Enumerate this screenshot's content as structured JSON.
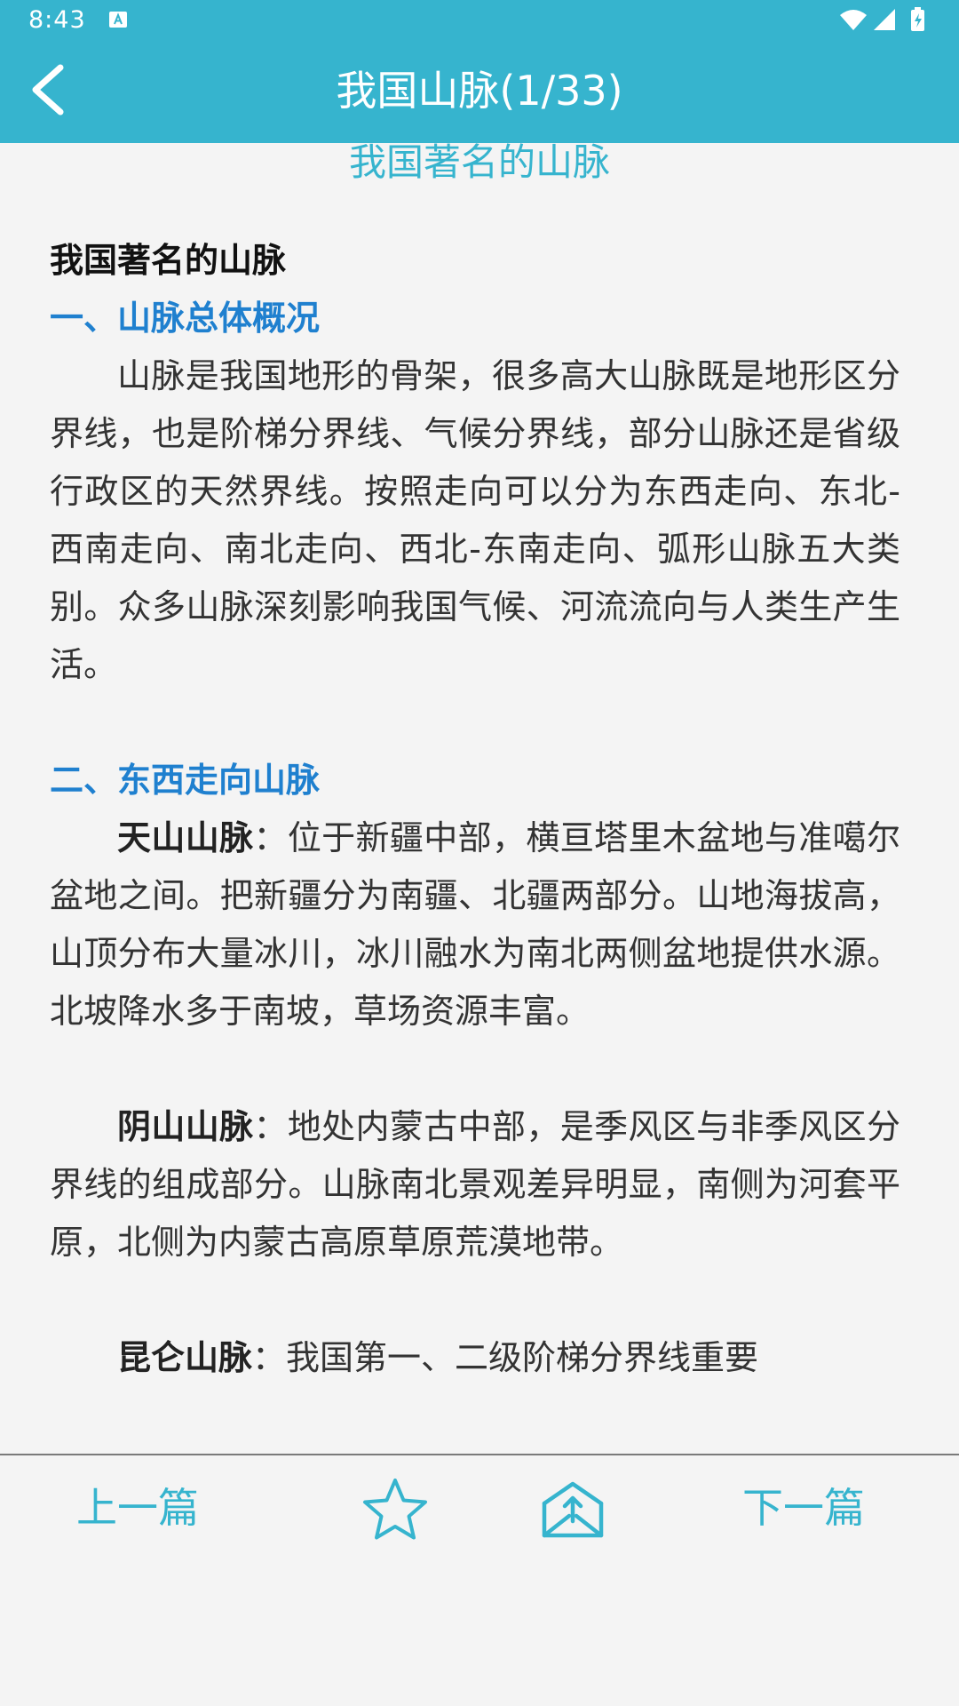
{
  "status_bar": {
    "time": "8:43",
    "icons": [
      "notification-a-icon",
      "wifi-icon",
      "signal-icon",
      "battery-charging-icon"
    ]
  },
  "header": {
    "title": "我国山脉(1/33)",
    "back_icon": "chevron-left-icon"
  },
  "article": {
    "heading": "我国著名的山脉",
    "doc_title": "我国著名的山脉",
    "section1_title": "一、山脉总体概况",
    "section1_text": "山脉是我国地形的骨架，很多高大山脉既是地形区分界线，也是阶梯分界线、气候分界线，部分山脉还是省级行政区的天然界线。按照走向可以分为东西走向、东北-西南走向、南北走向、西北-东南走向、弧形山脉五大类别。众多山脉深刻影响我国气候、河流流向与人类生产生活。",
    "section2_title": "二、东西走向山脉",
    "mountains": [
      {
        "name": "天山山脉",
        "text": "：位于新疆中部，横亘塔里木盆地与准噶尔盆地之间。把新疆分为南疆、北疆两部分。山地海拔高，山顶分布大量冰川，冰川融水为南北两侧盆地提供水源。北坡降水多于南坡，草场资源丰富。"
      },
      {
        "name": "阴山山脉",
        "text": "：地处内蒙古中部，是季风区与非季风区分界线的组成部分。山脉南北景观差异明显，南侧为河套平原，北侧为内蒙古高原草原荒漠地带。"
      },
      {
        "name": "昆仑山脉",
        "text": "：我国第一、二级阶梯分界线重要"
      }
    ]
  },
  "bottom_bar": {
    "prev_label": "上一篇",
    "next_label": "下一篇",
    "star_icon": "star-outline-icon",
    "share_icon": "share-box-icon"
  },
  "colors": {
    "accent": "#36b4ce",
    "section": "#1f80cf",
    "text": "#333333",
    "background": "#f4f4f4"
  }
}
